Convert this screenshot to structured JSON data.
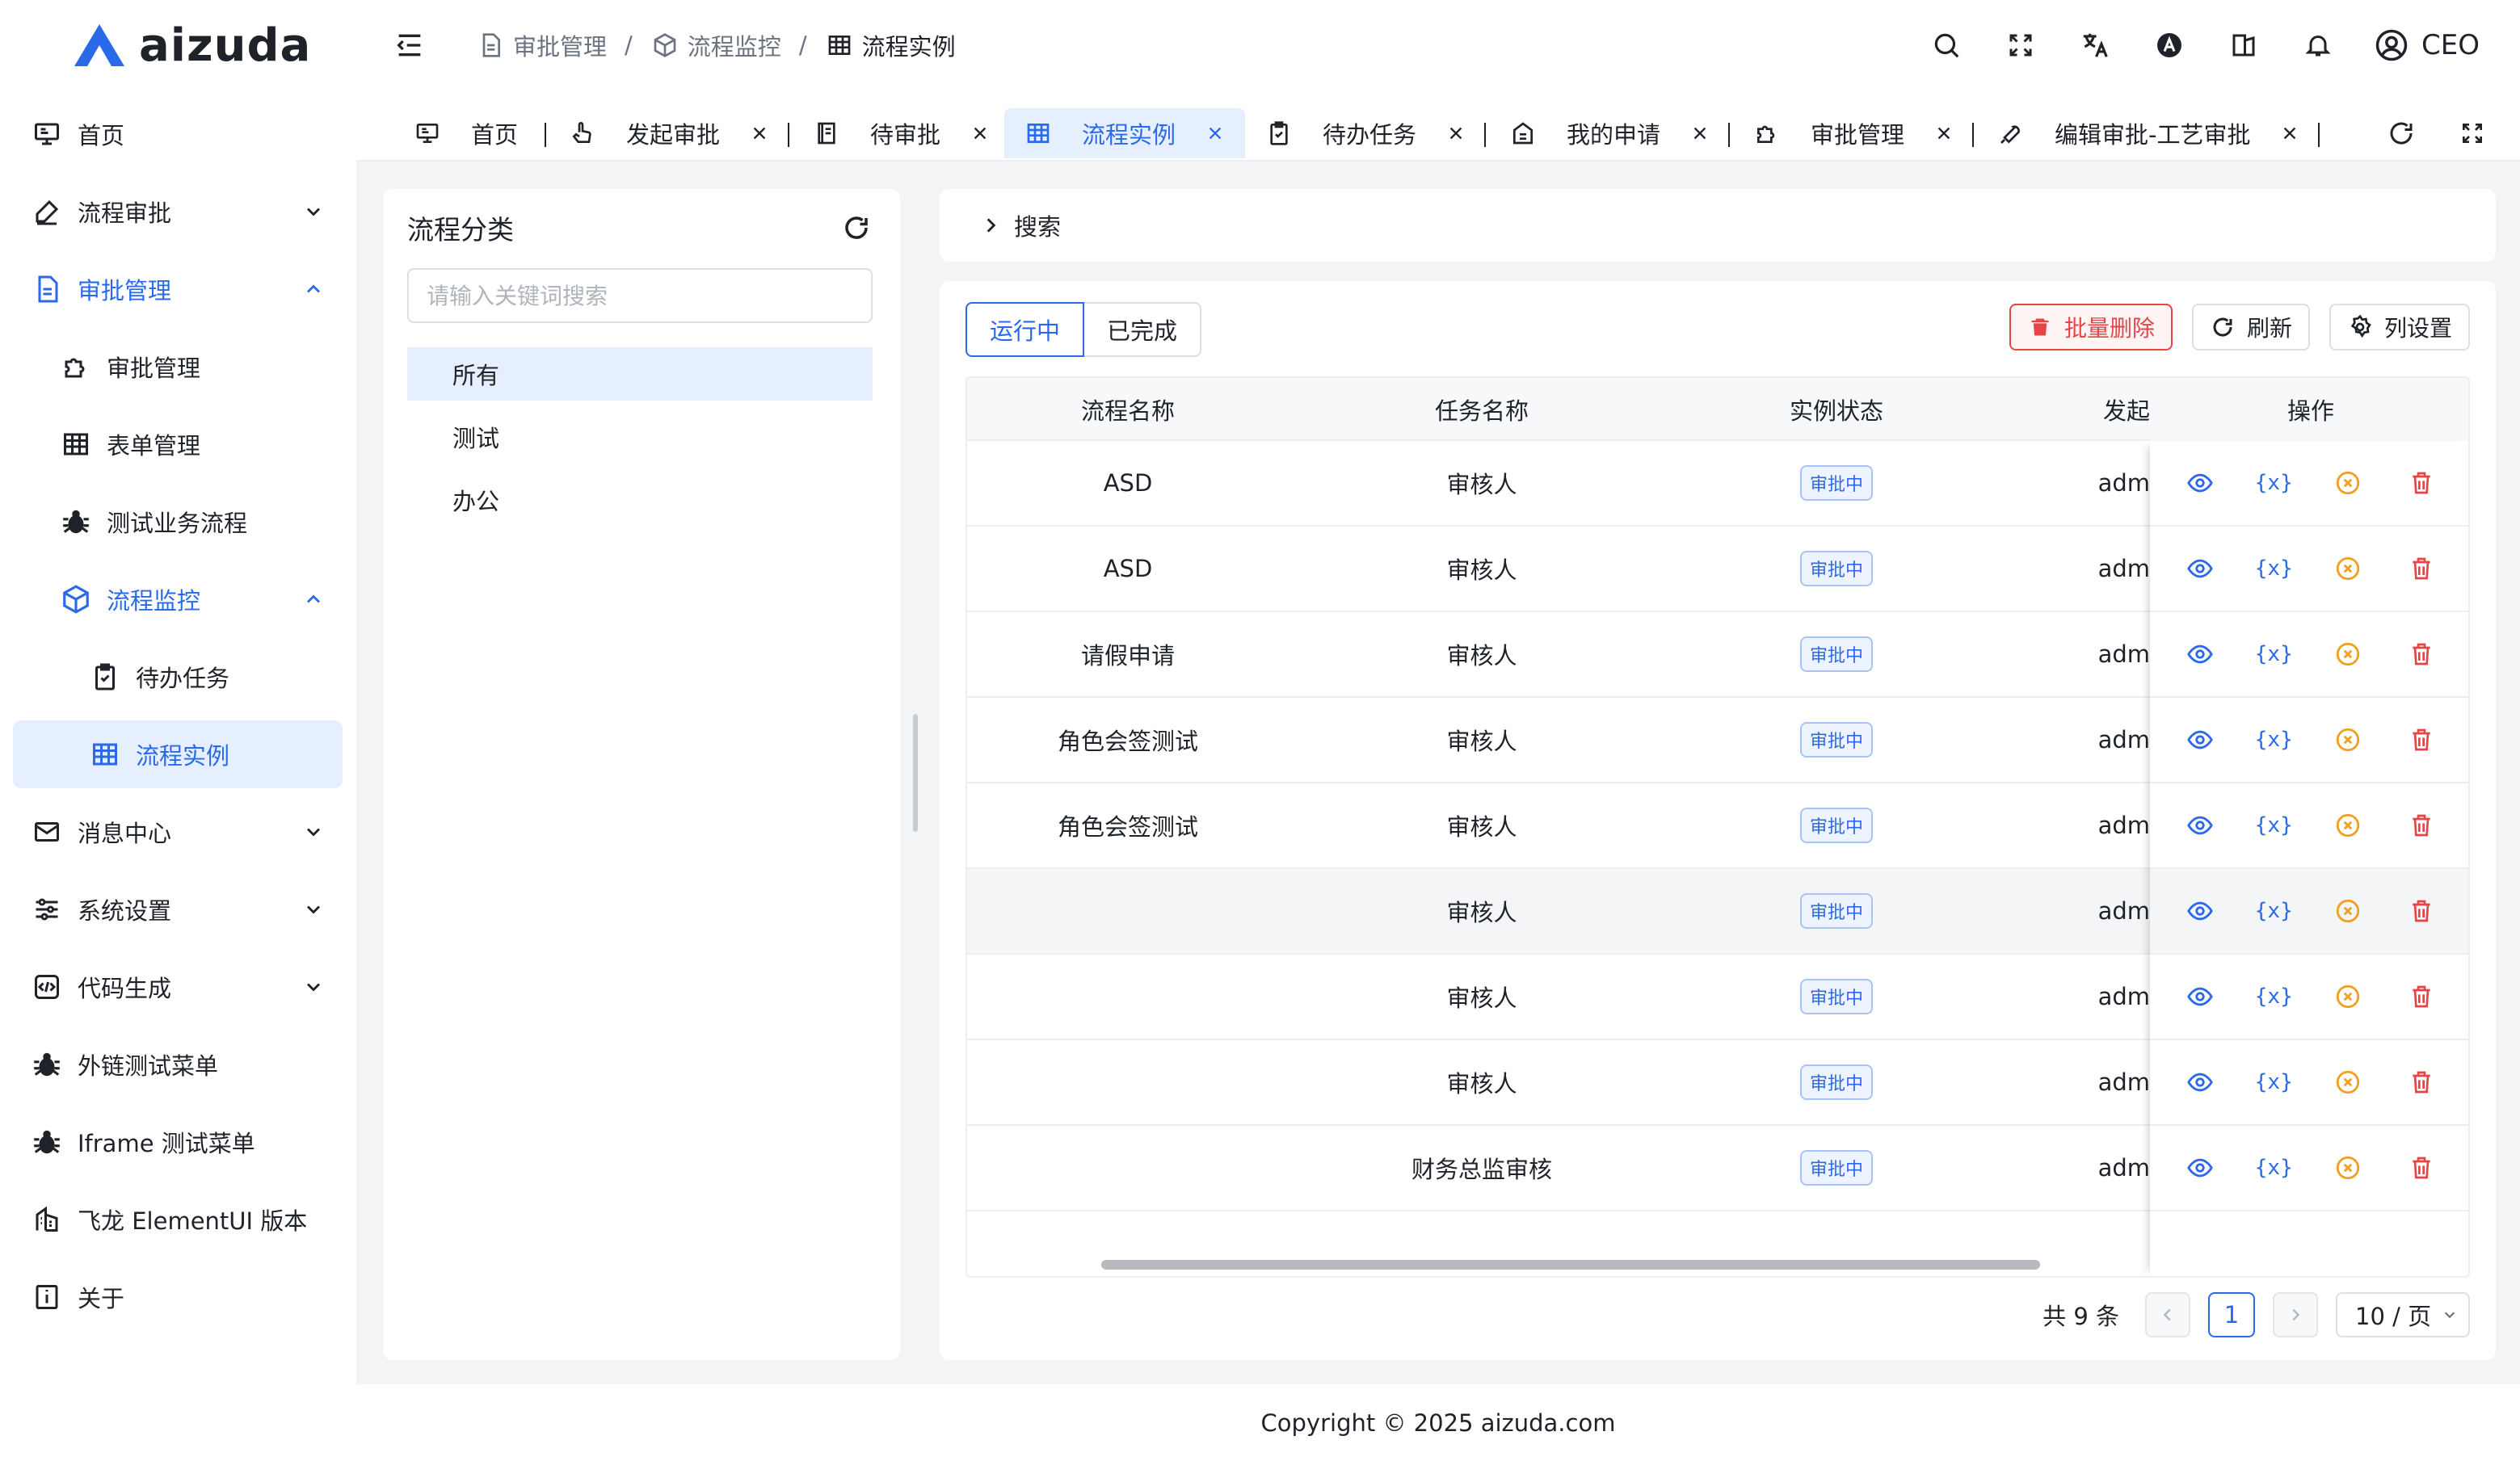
{
  "brand": {
    "name": "aizuda",
    "color": "#2a6ae9"
  },
  "sidebar": {
    "items": [
      {
        "label": "首页",
        "icon": "monitor-icon"
      },
      {
        "label": "流程审批",
        "icon": "pen-icon"
      },
      {
        "label": "审批管理",
        "icon": "document-icon"
      },
      {
        "label": "审批管理",
        "icon": "puzzle-icon"
      },
      {
        "label": "表单管理",
        "icon": "table-icon"
      },
      {
        "label": "测试业务流程",
        "icon": "bug-icon"
      },
      {
        "label": "流程监控",
        "icon": "cube-icon"
      },
      {
        "label": "待办任务",
        "icon": "clipboard-icon"
      },
      {
        "label": "流程实例",
        "icon": "table-icon"
      },
      {
        "label": "消息中心",
        "icon": "mail-icon"
      },
      {
        "label": "系统设置",
        "icon": "sliders-icon"
      },
      {
        "label": "代码生成",
        "icon": "code-icon"
      },
      {
        "label": "外链测试菜单",
        "icon": "bug-icon"
      },
      {
        "label": "Iframe 测试菜单",
        "icon": "bug-icon"
      },
      {
        "label": "飞龙 ElementUI 版本",
        "icon": "building-icon"
      },
      {
        "label": "关于",
        "icon": "info-icon"
      }
    ]
  },
  "header": {
    "breadcrumb": [
      "审批管理",
      "流程监控",
      "流程实例"
    ],
    "separator": "/",
    "user": "CEO"
  },
  "tabs": [
    {
      "label": "首页",
      "closable": false
    },
    {
      "label": "发起审批",
      "closable": true
    },
    {
      "label": "待审批",
      "closable": true
    },
    {
      "label": "流程实例",
      "closable": true,
      "active": true
    },
    {
      "label": "待办任务",
      "closable": true
    },
    {
      "label": "我的申请",
      "closable": true
    },
    {
      "label": "审批管理",
      "closable": true
    },
    {
      "label": "编辑审批-工艺审批",
      "closable": true
    }
  ],
  "category": {
    "title": "流程分类",
    "search_placeholder": "请输入关键词搜索",
    "items": [
      "所有",
      "测试",
      "办公"
    ]
  },
  "search": {
    "label": "搜索"
  },
  "segments": {
    "running": "运行中",
    "done": "已完成"
  },
  "toolbar": {
    "batch_delete": "批量删除",
    "refresh": "刷新",
    "columns": "列设置"
  },
  "table": {
    "headers": [
      "流程名称",
      "任务名称",
      "实例状态",
      "发起",
      "操作"
    ],
    "rows": [
      {
        "name": "ASD",
        "task": "审核人",
        "status": "审批中",
        "starter": "adm"
      },
      {
        "name": "ASD",
        "task": "审核人",
        "status": "审批中",
        "starter": "adm"
      },
      {
        "name": "请假申请",
        "task": "审核人",
        "status": "审批中",
        "starter": "adm"
      },
      {
        "name": "角色会签测试",
        "task": "审核人",
        "status": "审批中",
        "starter": "adm"
      },
      {
        "name": "角色会签测试",
        "task": "审核人",
        "status": "审批中",
        "starter": "adm"
      },
      {
        "name": "",
        "task": "审核人",
        "status": "审批中",
        "starter": "adm"
      },
      {
        "name": "",
        "task": "审核人",
        "status": "审批中",
        "starter": "adm"
      },
      {
        "name": "",
        "task": "审核人",
        "status": "审批中",
        "starter": "adm"
      },
      {
        "name": "",
        "task": "财务总监审核",
        "status": "审批中",
        "starter": "adm"
      }
    ],
    "var_icon_text": "{x}"
  },
  "pager": {
    "total": "共 9 条",
    "page": "1",
    "size": "10 / 页"
  },
  "footer": "Copyright © 2025 aizuda.com",
  "colors": {
    "primary": "#2a6ae9",
    "danger": "#e54545",
    "warning": "#f0a020"
  }
}
